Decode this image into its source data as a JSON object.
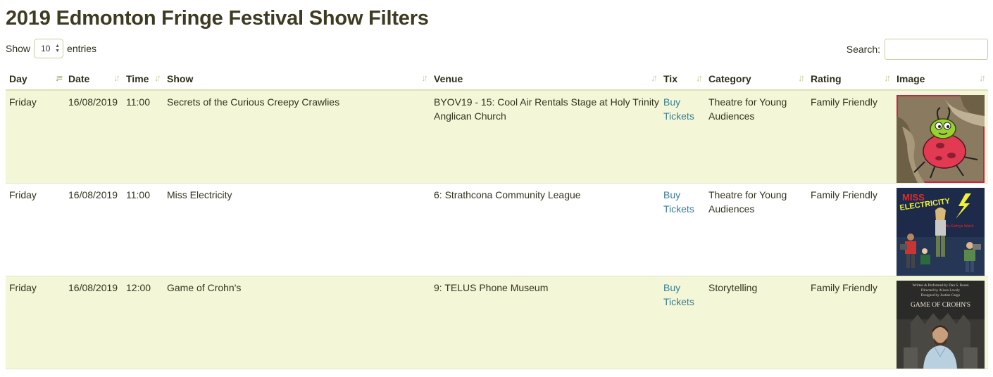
{
  "title": "2019 Edmonton Fringe Festival Show Filters",
  "length_control": {
    "prefix": "Show",
    "value": "10",
    "suffix": "entries"
  },
  "search": {
    "label": "Search:",
    "value": ""
  },
  "columns": [
    "Day",
    "Date",
    "Time",
    "Show",
    "Venue",
    "Tix",
    "Category",
    "Rating",
    "Image"
  ],
  "rows": [
    {
      "day": "Friday",
      "date": "16/08/2019",
      "time": "11:00",
      "show": "Secrets of the Curious Creepy Crawlies",
      "venue": "BYOV19 - 15: Cool Air Rentals Stage at Holy Trinity Anglican Church",
      "tix": "Buy Tickets",
      "category": "Theatre for Young Audiences",
      "rating": "Family Friendly",
      "image_icon": "cartoon-bug-image"
    },
    {
      "day": "Friday",
      "date": "16/08/2019",
      "time": "11:00",
      "show": "Miss Electricity",
      "venue": "6: Strathcona Community League",
      "tix": "Buy Tickets",
      "category": "Theatre for Young Audiences",
      "rating": "Family Friendly",
      "image_icon": "miss-electricity-poster",
      "image_text": {
        "line1": "MISS",
        "line2": "ELECTRICITY",
        "byline": "By Kathryn Walsh"
      }
    },
    {
      "day": "Friday",
      "date": "16/08/2019",
      "time": "12:00",
      "show": "Game of Crohn's",
      "venue": "9: TELUS Phone Museum",
      "tix": "Buy Tickets",
      "category": "Storytelling",
      "rating": "Family Friendly",
      "image_icon": "game-of-crohns-poster",
      "image_text": {
        "credit1": "Written & Performed by Dan S. Rosen",
        "credit2": "Directed by Alison Lovely",
        "credit3": "Designed by Justine Cargo",
        "title": "GAME OF CROHN'S"
      }
    }
  ],
  "colors": {
    "row_odd": "#f3f7d8",
    "link": "#3a7d95",
    "border": "#dfe3b5"
  }
}
